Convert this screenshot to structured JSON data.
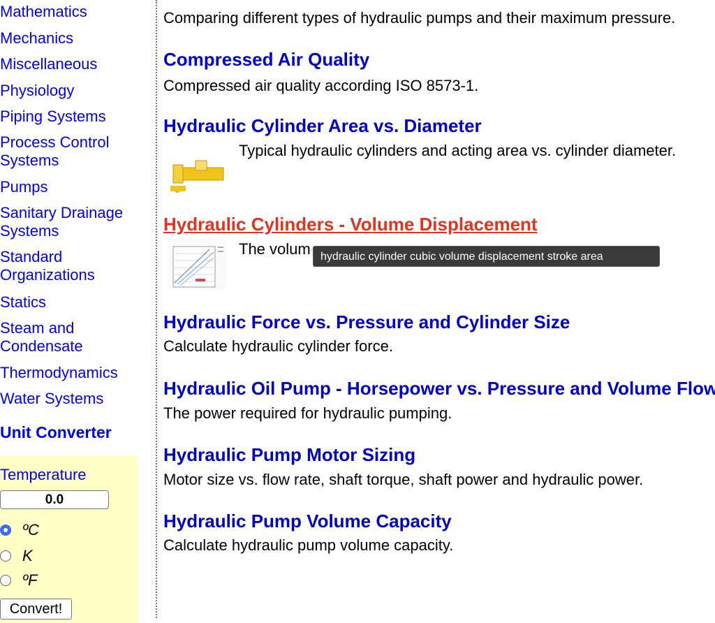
{
  "sidebar": {
    "items": [
      {
        "label": "Mathematics"
      },
      {
        "label": "Mechanics"
      },
      {
        "label": "Miscellaneous"
      },
      {
        "label": "Physiology"
      },
      {
        "label": "Piping Systems"
      },
      {
        "label": "Process Control Systems"
      },
      {
        "label": "Pumps"
      },
      {
        "label": "Sanitary Drainage Systems"
      },
      {
        "label": "Standard Organizations"
      },
      {
        "label": "Statics"
      },
      {
        "label": "Steam and Condensate"
      },
      {
        "label": "Thermodynamics"
      },
      {
        "label": "Water Systems"
      }
    ],
    "unit_converter": {
      "title": "Unit Converter",
      "quantity_label": "Temperature",
      "input_value": "0.0",
      "units": [
        {
          "label": "ºC",
          "selected": true
        },
        {
          "label": "K",
          "selected": false
        },
        {
          "label": "ºF",
          "selected": false
        }
      ],
      "convert_label": "Convert!"
    }
  },
  "main": {
    "entries": [
      {
        "desc": "Comparing different types of hydraulic pumps and their maximum pressure."
      },
      {
        "title": "Compressed Air Quality",
        "desc": "Compressed air quality according ISO 8573-1."
      },
      {
        "title": "Hydraulic Cylinder Area vs. Diameter",
        "desc": "Typical hydraulic cylinders and acting area vs. cylinder diameter."
      },
      {
        "title": "Hydraulic Cylinders - Volume Displacement",
        "desc": "The volumetric displacement of hydraulic cylinders."
      },
      {
        "title": "Hydraulic Force vs. Pressure and Cylinder Size",
        "desc": "Calculate hydraulic cylinder force."
      },
      {
        "title": "Hydraulic Oil Pump - Horsepower vs. Pressure and Volume Flow",
        "desc": "The power required for hydraulic pumping."
      },
      {
        "title": "Hydraulic Pump Motor Sizing",
        "desc": "Motor size vs. flow rate, shaft torque, shaft power and hydraulic power."
      },
      {
        "title": "Hydraulic Pump Volume Capacity",
        "desc": "Calculate hydraulic pump volume capacity."
      }
    ],
    "tooltip": "hydraulic cylinder cubic volume displacement stroke area"
  },
  "colors": {
    "link": "#0000cc",
    "link_hover": "#e3331f",
    "converter_bg": "#ffffc6",
    "tooltip_bg": "#3a3a3a"
  }
}
